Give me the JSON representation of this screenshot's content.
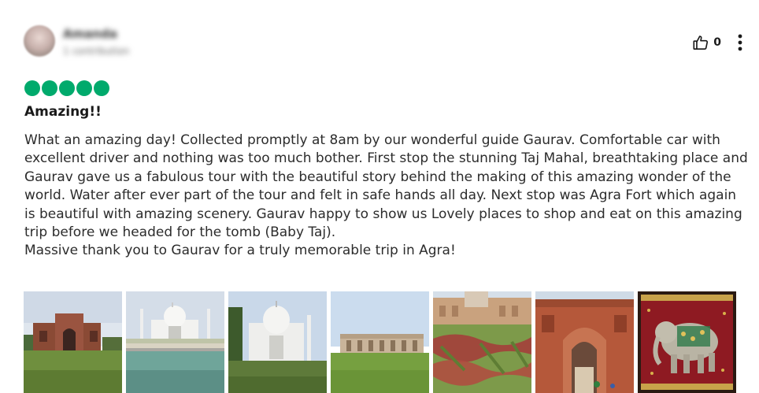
{
  "review": {
    "author_name": "Amanda",
    "author_meta": "1 contribution",
    "helpful_count": "0",
    "rating": 5,
    "title": "Amazing!!",
    "body": "What an amazing day! Collected promptly at 8am by our wonderful guide Gaurav. Comfortable car with excellent driver and nothing was too much bother. First stop the stunning Taj Mahal, breathtaking place and Gaurav gave us a fabulous tour with the beautiful story behind the making of this amazing wonder of the world. Water after ever part of the tour and felt in safe hands all day. Next stop was Agra Fort which again is beautiful with amazing scenery. Gaurav happy to show us Lovely places to shop and eat on this amazing trip before we headed for the tomb (Baby Taj).\nMassive thank you to Gaurav for a truly memorable trip in Agra!"
  },
  "icons": {
    "helpful": "thumbs-up-icon",
    "more": "more-vertical-icon",
    "rating": "rating-bubble-icon"
  },
  "colors": {
    "rating_green": "#00aa6c"
  }
}
